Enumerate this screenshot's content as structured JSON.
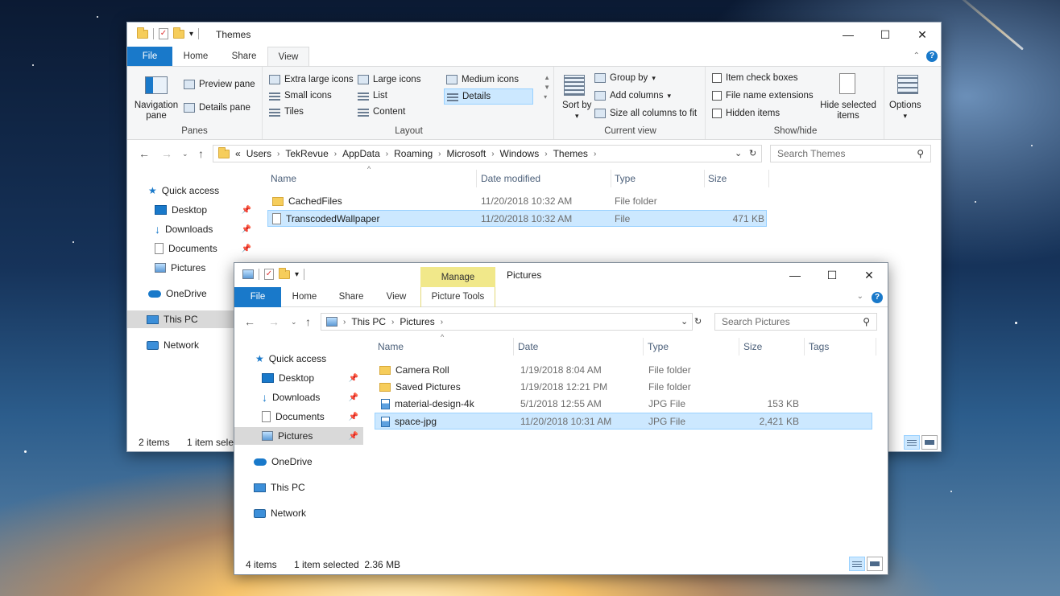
{
  "window_back": {
    "title": "Themes",
    "tabs": {
      "file": "File",
      "home": "Home",
      "share": "Share",
      "view": "View"
    },
    "ribbon": {
      "panes": {
        "navigation_pane": "Navigation pane",
        "preview_pane": "Preview pane",
        "details_pane": "Details pane",
        "label": "Panes"
      },
      "layout": {
        "items": [
          "Extra large icons",
          "Large icons",
          "Medium icons",
          "Small icons",
          "List",
          "Details",
          "Tiles",
          "Content"
        ],
        "selected": "Details",
        "label": "Layout"
      },
      "current_view": {
        "sort_by": "Sort by",
        "group_by": "Group by",
        "add_columns": "Add columns",
        "size_all_columns": "Size all columns to fit",
        "label": "Current view"
      },
      "show_hide": {
        "item_check_boxes": "Item check boxes",
        "file_name_extensions": "File name extensions",
        "hidden_items": "Hidden items",
        "hide_selected_items": "Hide selected items",
        "label": "Show/hide"
      },
      "options": "Options"
    },
    "address": {
      "overflow": "«",
      "crumbs": [
        "Users",
        "TekRevue",
        "AppData",
        "Roaming",
        "Microsoft",
        "Windows",
        "Themes"
      ]
    },
    "search_placeholder": "Search Themes",
    "nav": {
      "quick_access": "Quick access",
      "desktop": "Desktop",
      "downloads": "Downloads",
      "documents": "Documents",
      "pictures": "Pictures",
      "onedrive": "OneDrive",
      "this_pc": "This PC",
      "network": "Network"
    },
    "columns": {
      "name": "Name",
      "date": "Date modified",
      "type": "Type",
      "size": "Size"
    },
    "rows": [
      {
        "name": "CachedFiles",
        "date": "11/20/2018 10:32 AM",
        "type": "File folder",
        "size": ""
      },
      {
        "name": "TranscodedWallpaper",
        "date": "11/20/2018 10:32 AM",
        "type": "File",
        "size": "471 KB"
      }
    ],
    "status": {
      "count": "2 items",
      "selected": "1 item selec"
    }
  },
  "window_front": {
    "title": "Pictures",
    "contextual_tab": "Manage",
    "tabs": {
      "file": "File",
      "home": "Home",
      "share": "Share",
      "view": "View",
      "picture_tools": "Picture Tools"
    },
    "address": {
      "crumbs": [
        "This PC",
        "Pictures"
      ]
    },
    "search_placeholder": "Search Pictures",
    "nav": {
      "quick_access": "Quick access",
      "desktop": "Desktop",
      "downloads": "Downloads",
      "documents": "Documents",
      "pictures": "Pictures",
      "onedrive": "OneDrive",
      "this_pc": "This PC",
      "network": "Network"
    },
    "columns": {
      "name": "Name",
      "date": "Date",
      "type": "Type",
      "size": "Size",
      "tags": "Tags"
    },
    "rows": [
      {
        "name": "Camera Roll",
        "date": "1/19/2018 8:04 AM",
        "type": "File folder",
        "size": "",
        "icon": "folder-icon"
      },
      {
        "name": "Saved Pictures",
        "date": "1/19/2018 12:21 PM",
        "type": "File folder",
        "size": "",
        "icon": "folder-icon"
      },
      {
        "name": "material-design-4k",
        "date": "5/1/2018 12:55 AM",
        "type": "JPG File",
        "size": "153 KB",
        "icon": "image-file-icon"
      },
      {
        "name": "space-jpg",
        "date": "11/20/2018 10:31 AM",
        "type": "JPG File",
        "size": "2,421 KB",
        "icon": "image-file-icon"
      }
    ],
    "status": {
      "count": "4 items",
      "selected": "1 item selected  2.36 MB"
    }
  },
  "colors": {
    "accent": "#1979ca",
    "selection": "#cce8ff",
    "manage_tab": "#f1e88a"
  }
}
